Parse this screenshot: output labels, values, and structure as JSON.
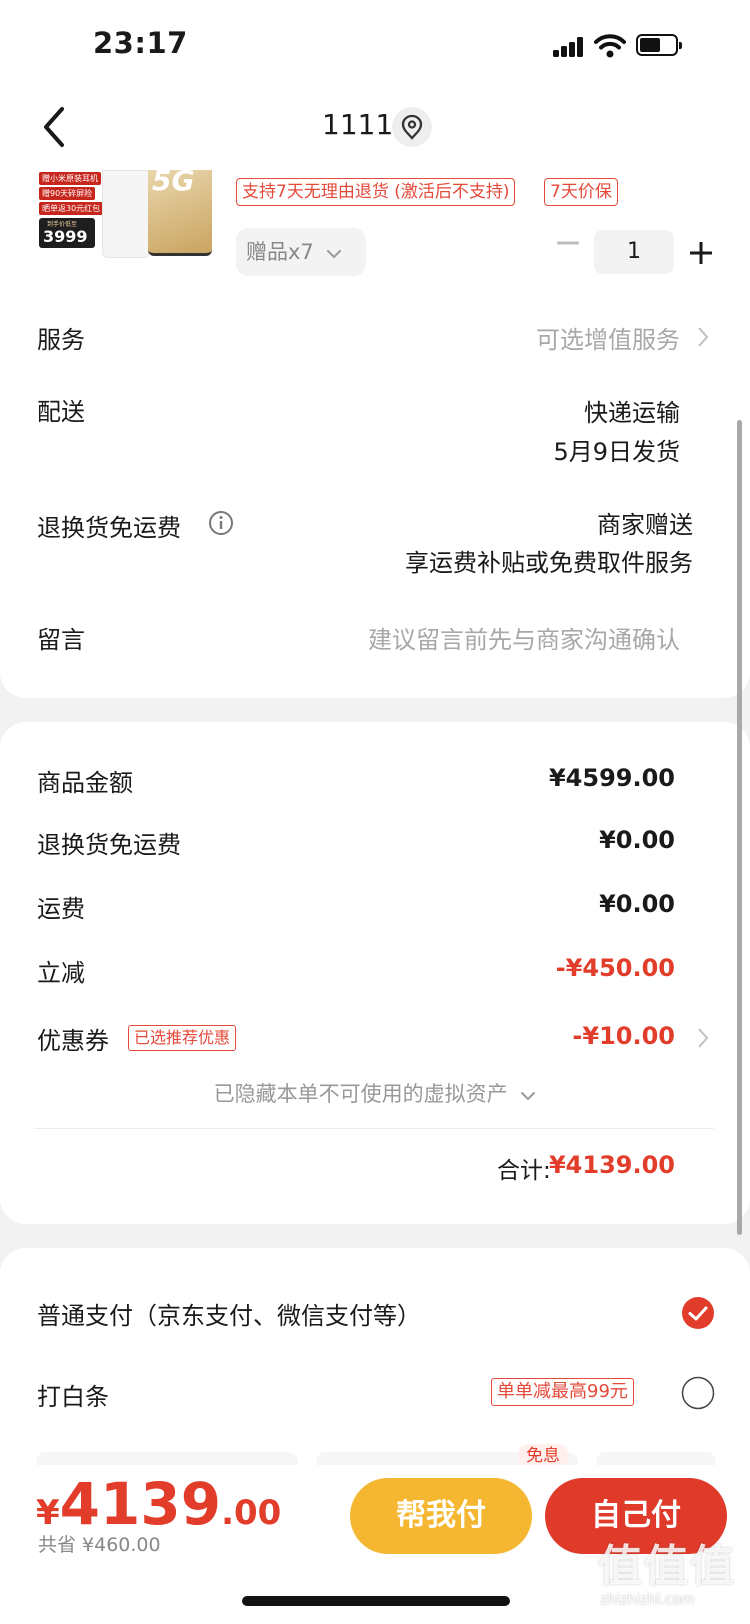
{
  "status_bar": {
    "time": "23:17"
  },
  "header": {
    "title": "1111"
  },
  "product": {
    "gift_tags": [
      "赠小米原装耳机",
      "赠90天碎屏险",
      "晒单返30元红包"
    ],
    "thumb_price_label": "到手价低至",
    "thumb_price": "3999",
    "thumb_badge": "5G",
    "tags": [
      "支持7天无理由退货 (激活后不支持)",
      "7天价保"
    ],
    "gift_dropdown": "赠品x7",
    "quantity": "1"
  },
  "details": {
    "service_label": "服务",
    "service_value": "可选增值服务",
    "delivery_label": "配送",
    "delivery_value_1": "快递运输",
    "delivery_value_2": "5月9日发货",
    "return_label": "退换货免运费",
    "return_value_1": "商家赠送",
    "return_value_2": "享运费补贴或免费取件服务",
    "message_label": "留言",
    "message_placeholder": "建议留言前先与商家沟通确认"
  },
  "price": {
    "goods_label": "商品金额",
    "goods_value": "¥4599.00",
    "return_fee_label": "退换货免运费",
    "return_fee_value": "¥0.00",
    "shipping_label": "运费",
    "shipping_value": "¥0.00",
    "discount_label": "立减",
    "discount_value": "-¥450.00",
    "coupon_label": "优惠券",
    "coupon_tag": "已选推荐优惠",
    "coupon_value": "-¥10.00",
    "hidden_assets": "已隐藏本单不可使用的虚拟资产",
    "total_label": "合计:",
    "total_value": "¥4139.00"
  },
  "payment": {
    "normal_label": "普通支付（京东支付、微信支付等）",
    "baitiao_label": "打白条",
    "baitiao_tag": "单单减最高99元",
    "interest_free_tag": "免息"
  },
  "bottom": {
    "currency": "¥",
    "price_int": "4139",
    "price_dec": ".00",
    "saved": "共省 ¥460.00",
    "help_pay": "帮我付",
    "self_pay": "自己付"
  },
  "watermark": {
    "text": "值值值",
    "url": "zhizhizhi.com"
  },
  "colors": {
    "accent": "#e23c2b",
    "help_button": "#f5b731",
    "self_button": "#e03a2b"
  }
}
